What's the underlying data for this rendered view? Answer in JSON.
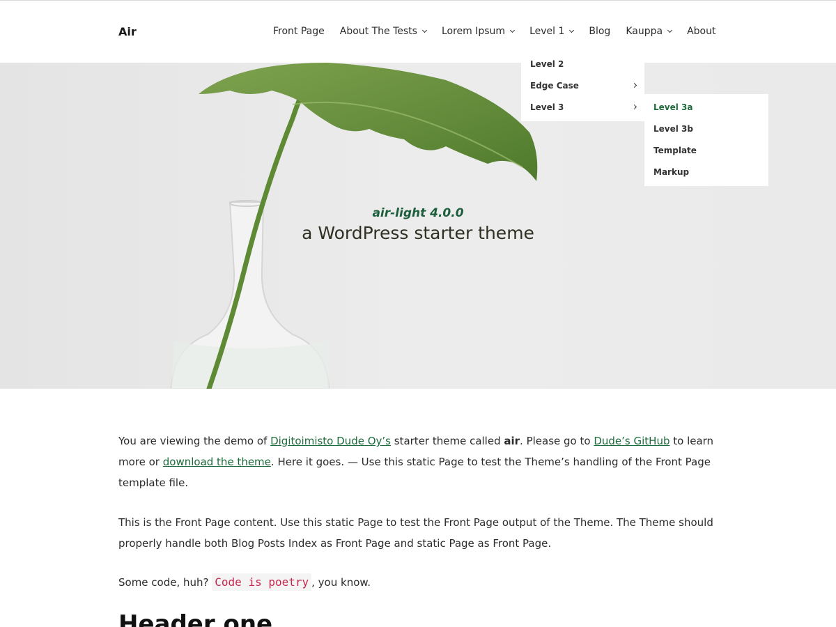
{
  "site": {
    "title": "Air"
  },
  "nav": {
    "items": [
      {
        "label": "Front Page",
        "has_dropdown": false
      },
      {
        "label": "About The Tests",
        "has_dropdown": true
      },
      {
        "label": "Lorem Ipsum",
        "has_dropdown": true
      },
      {
        "label": "Level 1",
        "has_dropdown": true
      },
      {
        "label": "Blog",
        "has_dropdown": false
      },
      {
        "label": "Kauppa",
        "has_dropdown": true
      },
      {
        "label": "About",
        "has_dropdown": false
      }
    ],
    "submenu_level1": [
      {
        "label": "Level 2",
        "has_children": false
      },
      {
        "label": "Edge Case",
        "has_children": true
      },
      {
        "label": "Level 3",
        "has_children": true
      }
    ],
    "submenu_level3": [
      {
        "label": "Level 3a",
        "active": true
      },
      {
        "label": "Level 3b",
        "active": false
      },
      {
        "label": "Template",
        "active": false
      },
      {
        "label": "Markup",
        "active": false
      }
    ]
  },
  "hero": {
    "subtitle": "air-light 4.0.0",
    "title": "a WordPress starter theme"
  },
  "content": {
    "p1": {
      "t1": "You are viewing the demo of ",
      "link1": "Digitoimisto Dude Oy’s",
      "t2": " starter theme called ",
      "bold": "air",
      "t3": ". Please go to ",
      "link2": "Dude’s GitHub",
      "t4": " to learn more or ",
      "link3": "download the theme",
      "t5": ". Here it goes. — Use this static Page to test the Theme’s handling of the Front Page template file."
    },
    "p2": "This is the Front Page content. Use this static Page to test the Front Page output of the Theme. The Theme should properly handle both Blog Posts Index as Front Page and static Page as Front Page.",
    "p3": {
      "t1": "Some code, huh? ",
      "code": "Code is poetry",
      "t2": ", you know."
    },
    "heading": "Header one"
  },
  "colors": {
    "accent": "#1d6b3a",
    "hero_bg": "#ebebeb",
    "code": "#c7254e"
  }
}
